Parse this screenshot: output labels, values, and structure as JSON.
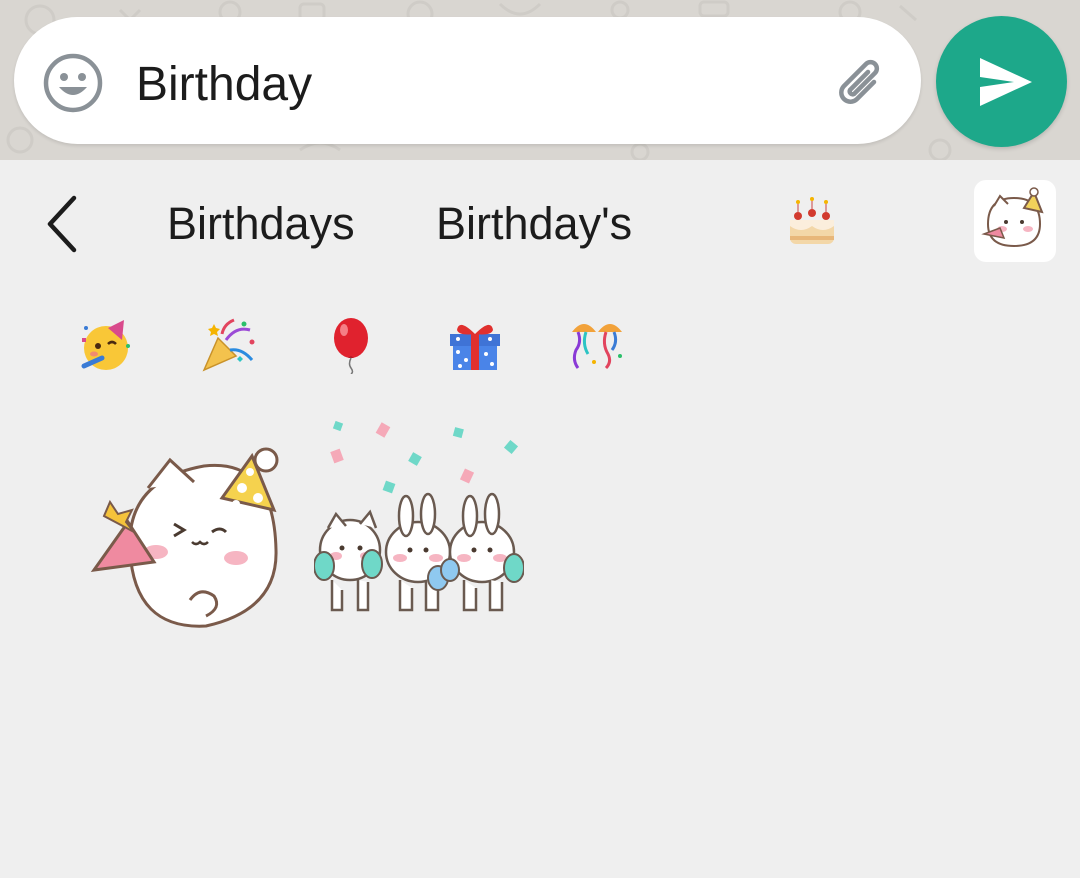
{
  "compose": {
    "text": "Birthday",
    "emoji_button": "smiley-icon",
    "attach_button": "paperclip-icon",
    "send_button": "send-icon"
  },
  "suggestions": {
    "back": "chevron-left-icon",
    "words": [
      "Birthdays",
      "Birthday's"
    ],
    "emoji": "birthday-cake-emoji",
    "sticker": "party-cat-sticker"
  },
  "emoji_row": [
    "partying-face-emoji",
    "party-popper-emoji",
    "balloon-emoji",
    "wrapped-gift-emoji",
    "confetti-streamers-emoji"
  ],
  "stickers": [
    "party-cat-sticker",
    "bunnies-confetti-sticker"
  ],
  "colors": {
    "send": "#1da88a",
    "panel": "#efefef",
    "chat_bg": "#d9d6d1"
  }
}
